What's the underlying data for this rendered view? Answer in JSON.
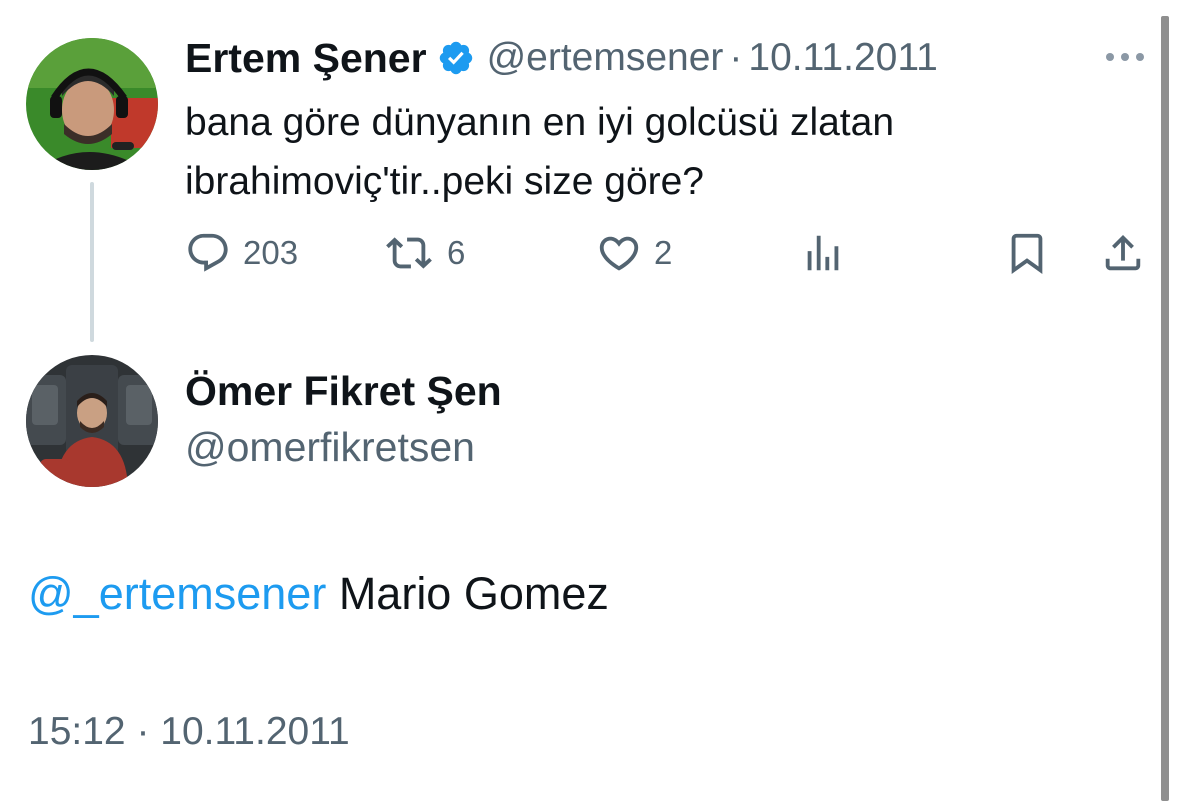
{
  "parent_tweet": {
    "author_name": "Ertem Şener",
    "verified_icon": "verified-badge-icon",
    "handle": "@ertemsener",
    "separator": "·",
    "date": "10.11.2011",
    "text": "bana göre dünyanın en iyi golcüsü zlatan ibrahimoviç'tir..peki size göre?",
    "more_icon": "more-dots-icon",
    "actions": {
      "reply_count": "203",
      "retweet_count": "6",
      "like_count": "2"
    }
  },
  "reply_tweet": {
    "author_name": "Ömer Fikret Şen",
    "handle": "@omerfikretsen",
    "mention": "@_ertemsener",
    "text": " Mario Gomez",
    "time": "15:12",
    "separator": "·",
    "date": "10.11.2011"
  },
  "colors": {
    "accent": "#1d9bf0",
    "secondary_text": "#536471",
    "primary_text": "#0f1419",
    "thread_line": "#cfd9de"
  }
}
